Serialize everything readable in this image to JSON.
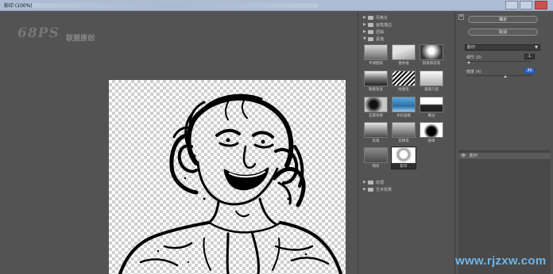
{
  "window": {
    "title": "影印 (100%)"
  },
  "logo": {
    "mark": "68PS",
    "text": "联盟原创"
  },
  "gallery": {
    "categories_top": [
      {
        "label": "风格化",
        "expanded": false
      },
      {
        "label": "画笔描边",
        "expanded": false
      },
      {
        "label": "扭曲",
        "expanded": false
      },
      {
        "label": "素描",
        "expanded": true
      }
    ],
    "thumbs": [
      {
        "label": "半调图案"
      },
      {
        "label": "便条纸"
      },
      {
        "label": "粉笔和炭笔"
      },
      {
        "label": "铬黄渐变"
      },
      {
        "label": "绘图笔"
      },
      {
        "label": "基底凸现"
      },
      {
        "label": "石膏效果"
      },
      {
        "label": "水彩画纸"
      },
      {
        "label": "撕边"
      },
      {
        "label": "炭笔"
      },
      {
        "label": "炭精笔"
      },
      {
        "label": "图章"
      },
      {
        "label": "网状"
      },
      {
        "label": "影印"
      }
    ],
    "selected": "影印",
    "categories_bottom": [
      {
        "label": "纹理",
        "expanded": false
      },
      {
        "label": "艺术效果",
        "expanded": false
      }
    ]
  },
  "panel": {
    "ok_label": "确定",
    "cancel_label": "取消",
    "toggle_symbol": "≡",
    "filter_select": "影印",
    "params": [
      {
        "label": "细节 (D)",
        "value": "1",
        "fraction": 0.04
      },
      {
        "label": "暗度 (A)",
        "value": "30",
        "fraction": 0.6
      }
    ]
  },
  "layers": [
    {
      "name": "影印",
      "visible": true
    }
  ],
  "watermark": {
    "text": "www.rjzxw.com"
  }
}
